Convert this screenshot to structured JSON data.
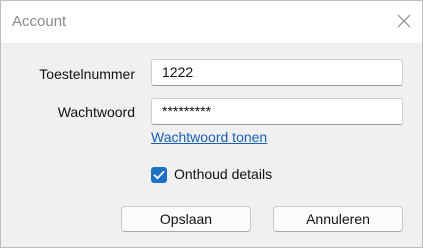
{
  "window": {
    "title": "Account"
  },
  "form": {
    "extension_label": "Toestelnummer",
    "extension_value": "1222",
    "password_label": "Wachtwoord",
    "password_value": "*********",
    "show_password_link": "Wachtwoord tonen",
    "remember_label": "Onthoud details",
    "remember_checked": true
  },
  "buttons": {
    "save_label": "Opslaan",
    "cancel_label": "Annuleren"
  },
  "colors": {
    "accent": "#1f6fc4",
    "link": "#1a5fb4"
  },
  "icons": {
    "close": "close-icon",
    "check": "checkmark-icon"
  }
}
